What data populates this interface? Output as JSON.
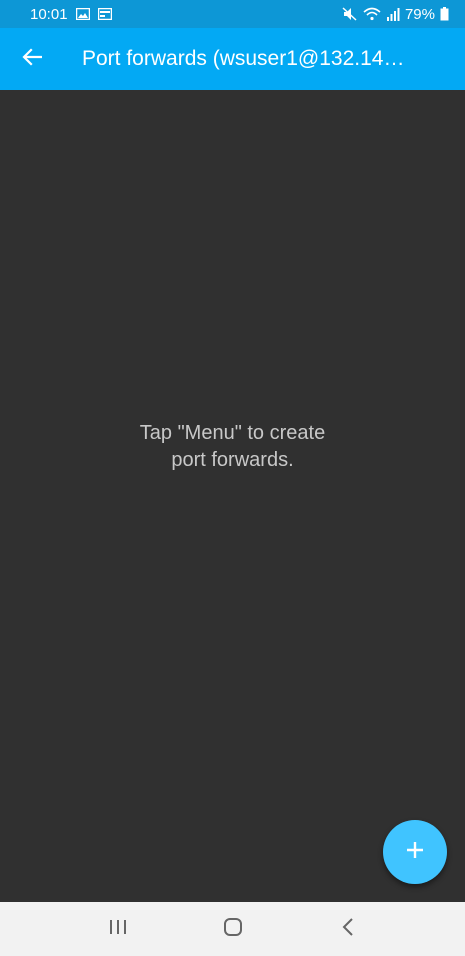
{
  "status_bar": {
    "time": "10:01",
    "battery": "79%",
    "icons": [
      "image-icon",
      "card-icon",
      "mute-icon",
      "wifi-icon",
      "signal-icon",
      "battery-icon"
    ]
  },
  "app_bar": {
    "title": "Port forwards (wsuser1@132.14…",
    "back_icon": "arrow-left-icon"
  },
  "content": {
    "empty_line1": "Tap \"Menu\" to create",
    "empty_line2": "port forwards."
  },
  "fab": {
    "icon": "plus-icon"
  },
  "nav_bar": {
    "icons": [
      "recent-apps-icon",
      "home-icon",
      "back-icon"
    ]
  },
  "colors": {
    "status_bar": "#0d97d6",
    "app_bar": "#03a9f4",
    "background": "#303030",
    "fab": "#40c4ff",
    "nav_bar": "#f2f2f2"
  }
}
